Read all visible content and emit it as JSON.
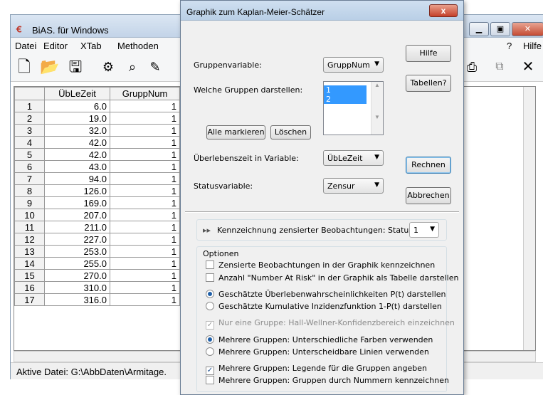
{
  "main": {
    "title": "BiAS. für Windows",
    "menu": [
      "Datei",
      "Editor",
      "XTab",
      "Methoden",
      "?",
      "Hilfe"
    ],
    "columns": [
      "",
      "ÜbLeZeit",
      "GruppNum"
    ],
    "rows": [
      [
        "1",
        "6.0",
        "1"
      ],
      [
        "2",
        "19.0",
        "1"
      ],
      [
        "3",
        "32.0",
        "1"
      ],
      [
        "4",
        "42.0",
        "1"
      ],
      [
        "5",
        "42.0",
        "1"
      ],
      [
        "6",
        "43.0",
        "1"
      ],
      [
        "7",
        "94.0",
        "1"
      ],
      [
        "8",
        "126.0",
        "1"
      ],
      [
        "9",
        "169.0",
        "1"
      ],
      [
        "10",
        "207.0",
        "1"
      ],
      [
        "11",
        "211.0",
        "1"
      ],
      [
        "12",
        "227.0",
        "1"
      ],
      [
        "13",
        "253.0",
        "1"
      ],
      [
        "14",
        "255.0",
        "1"
      ],
      [
        "15",
        "270.0",
        "1"
      ],
      [
        "16",
        "310.0",
        "1"
      ],
      [
        "17",
        "316.0",
        "1"
      ]
    ],
    "status": "Aktive Datei: G:\\AbbDaten\\Armitage."
  },
  "dialog": {
    "title": "Graphik zum Kaplan-Meier-Schätzer",
    "close": "x",
    "group_var_label": "Gruppenvariable:",
    "group_var_value": "GruppNum",
    "groups_label": "Welche Gruppen darstellen:",
    "groups": [
      "1",
      "2"
    ],
    "mark_all": "Alle markieren",
    "clear": "Löschen",
    "survival_label": "Überlebenszeit in Variable:",
    "survival_value": "ÜbLeZeit",
    "status_label": "Statusvariable:",
    "status_value": "Zensur",
    "help": "Hilfe",
    "tables": "Tabellen?",
    "compute": "Rechnen",
    "cancel": "Abbrechen",
    "marking_text": "Kennzeichnung zensierter Beobachtungen: Status =",
    "marking_value": "1",
    "options_title": "Optionen",
    "opt_censored": "Zensierte Beobachtungen in der Graphik kennzeichnen",
    "opt_risk": "Anzahl \"Number At Risk\" in der Graphik als Tabelle darstellen",
    "opt_survival": "Geschätzte Überlebenwahrscheinlichkeiten P(t) darstellen",
    "opt_incidence": "Geschätzte Kumulative Inzidenzfunktion 1-P(t) darstellen",
    "opt_hall": "Nur eine Gruppe: Hall-Wellner-Konfidenzbereich einzeichnen",
    "opt_colors": "Mehrere Gruppen: Unterschiedliche Farben verwenden",
    "opt_lines": "Mehrere Gruppen: Unterscheidbare Linien verwenden",
    "opt_legend": "Mehrere Gruppen: Legende für die Gruppen angeben",
    "opt_numbers": "Mehrere Gruppen: Gruppen durch Nummern kennzeichnen"
  }
}
